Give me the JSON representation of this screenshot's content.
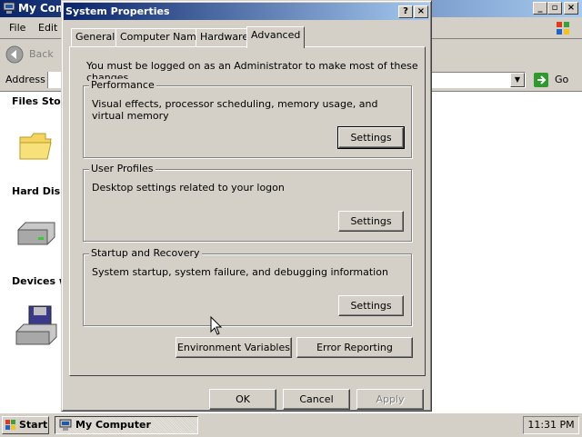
{
  "background_window": {
    "title": "My Comp",
    "menu": [
      "File",
      "Edit"
    ],
    "toolbar": {
      "back_label": "Back"
    },
    "address": {
      "label": "Address",
      "go_label": "Go"
    },
    "sections": [
      "Files Stor",
      "Hard Disk",
      "Devices w"
    ]
  },
  "dialog": {
    "title": "System Properties",
    "help_label": "?",
    "close_label": "×",
    "tabs": [
      "General",
      "Computer Name",
      "Hardware",
      "Advanced"
    ],
    "active_tab": "Advanced",
    "notice": "You must be logged on as an Administrator to make most of these changes.",
    "groups": [
      {
        "label": "Performance",
        "description": "Visual effects, processor scheduling, memory usage, and virtual memory",
        "button": "Settings"
      },
      {
        "label": "User Profiles",
        "description": "Desktop settings related to your logon",
        "button": "Settings"
      },
      {
        "label": "Startup and Recovery",
        "description": "System startup, system failure, and debugging information",
        "button": "Settings"
      }
    ],
    "env_button": "Environment Variables",
    "error_button": "Error Reporting",
    "ok_button": "OK",
    "cancel_button": "Cancel",
    "apply_button": "Apply"
  },
  "taskbar": {
    "start_label": "Start",
    "task_label": "My Computer",
    "clock": "11:31 PM"
  },
  "colors": {
    "titlebar_start": "#0a246a",
    "titlebar_end": "#a6caf0",
    "face": "#d4d0c8"
  }
}
